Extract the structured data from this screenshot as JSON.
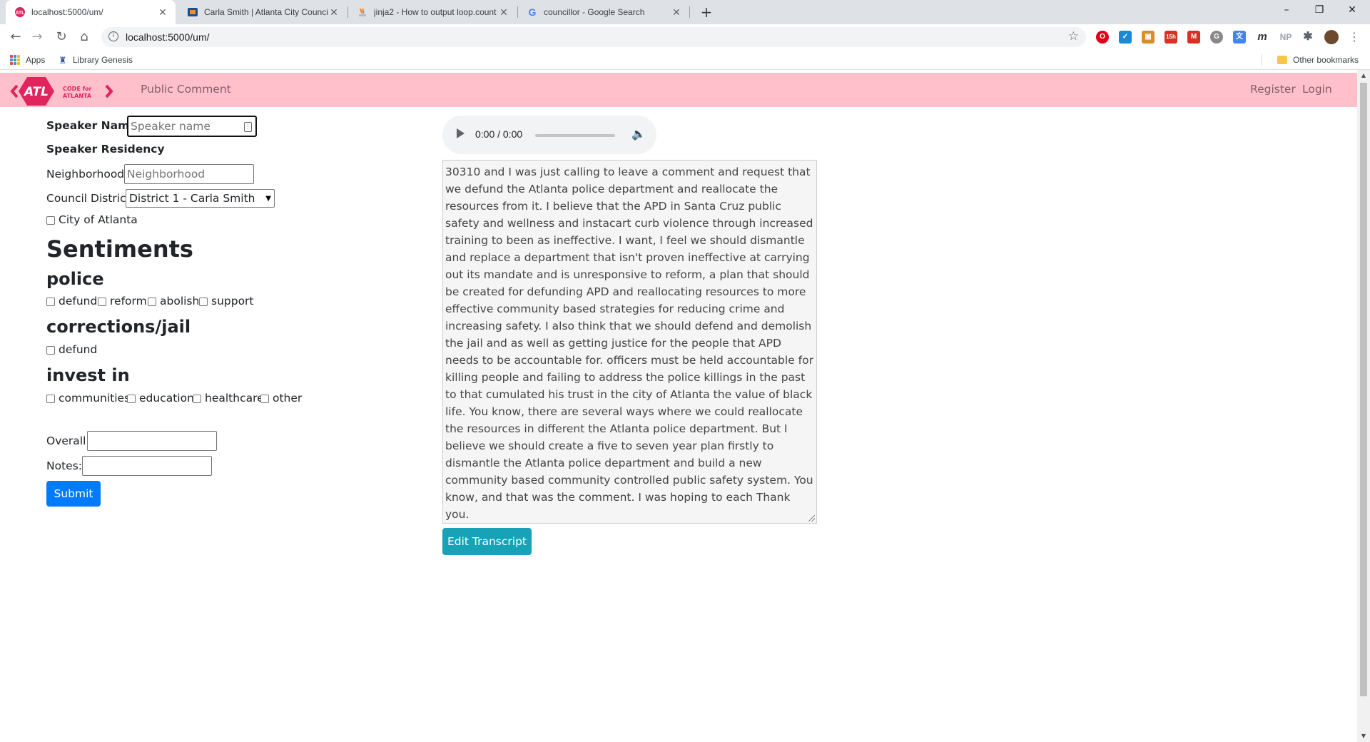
{
  "browser": {
    "tabs": [
      {
        "title": "localhost:5000/um/",
        "active": true
      },
      {
        "title": "Carla Smith | Atlanta City Council",
        "active": false
      },
      {
        "title": "jinja2 - How to output loop.count",
        "active": false
      },
      {
        "title": "councillor - Google Search",
        "active": false
      }
    ],
    "url": "localhost:5000/um/",
    "bookmarks": {
      "apps": "Apps",
      "library": "Library Genesis",
      "other": "Other bookmarks"
    },
    "extensions": [
      "opera-icon",
      "check-icon",
      "wallet-icon",
      "calendar-icon",
      "gmail-icon",
      "grammarly-icon",
      "translate-icon",
      "m-icon",
      "np-icon",
      "puzzle-icon",
      "profile-avatar"
    ],
    "ext_labels": {
      "np": "NP",
      "m": "m",
      "cal": "15h"
    }
  },
  "nav": {
    "logo_text": "CODE for ATLANTA",
    "logo_mark": "ATL",
    "brand_link": "Public Comment",
    "register": "Register",
    "login": "Login"
  },
  "form": {
    "speaker_name_label": "Speaker Name",
    "speaker_name_placeholder": "Speaker name",
    "residency_label": "Speaker Residency",
    "neighborhood_label": "Neighborhood",
    "neighborhood_placeholder": "Neighborhood",
    "district_label": "Council District",
    "district_selected": "District 1 - Carla Smith",
    "city_label": "City of Atlanta",
    "sentiments_heading": "Sentiments",
    "police_heading": "police",
    "police_options": [
      "defund",
      "reform",
      "abolish",
      "support"
    ],
    "corrections_heading": "corrections/jail",
    "corrections_options": [
      "defund"
    ],
    "invest_heading": "invest in",
    "invest_options": [
      "communities",
      "education",
      "healthcare",
      "other"
    ],
    "overall_label": "Overall:",
    "notes_label": "Notes:",
    "submit": "Submit"
  },
  "audio": {
    "time": "0:00 / 0:00"
  },
  "transcript": {
    "text": "30310 and I was just calling to leave a comment and request that we defund the Atlanta police department and reallocate the resources from it. I believe that the APD in Santa Cruz public safety and wellness and instacart curb violence through increased training to been as ineffective. I want, I feel we should dismantle and replace a department that isn't proven ineffective at carrying out its mandate and is unresponsive to reform, a plan that should be created for defunding APD and reallocating resources to more effective community based strategies for reducing crime and increasing safety. I also think that we should defend and demolish the jail and as well as getting justice for the people that APD needs to be accountable for. officers must be held accountable for killing people and failing to address the police killings in the past to that cumulated his trust in the city of Atlanta the value of black life. You know, there are several ways where we could reallocate the resources in different the Atlanta police department. But I believe we should create a five to seven year plan firstly to dismantle the Atlanta police department and build a new community based community controlled public safety system. You know, and that was the comment. I was hoping to each Thank you.",
    "edit_button": "Edit Transcript"
  },
  "colors": {
    "navbar": "#ffc0cb",
    "logo": "#e0245e",
    "primary": "#007bff",
    "info": "#17a2b8"
  }
}
